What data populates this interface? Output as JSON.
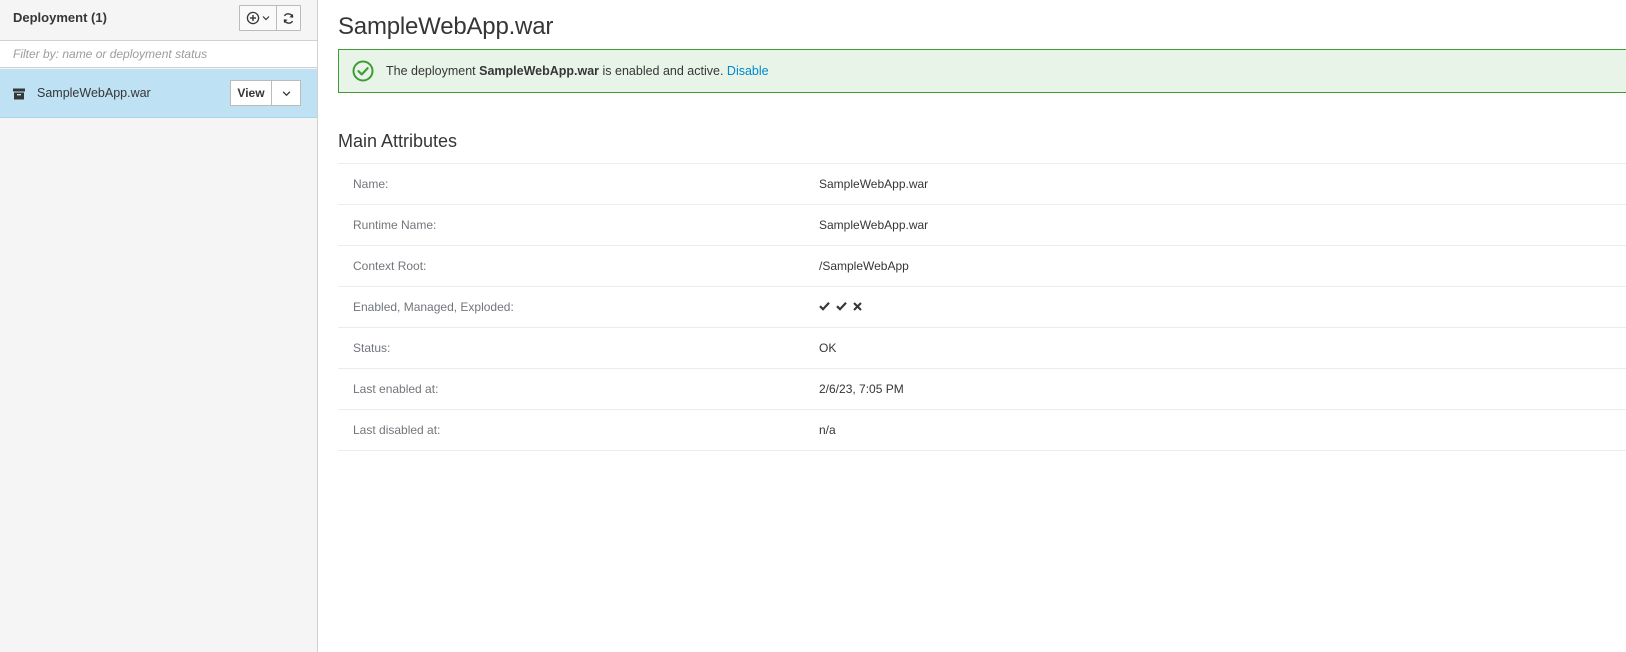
{
  "sidebar": {
    "title": "Deployment (1)",
    "add_icon": "plus-circle-icon",
    "refresh_icon": "refresh-icon",
    "filter_placeholder": "Filter by: name or deployment status",
    "items": [
      {
        "label": "SampleWebApp.war",
        "icon": "archive-icon",
        "view_label": "View"
      }
    ]
  },
  "main": {
    "title": "SampleWebApp.war",
    "alert": {
      "prefix": "The deployment ",
      "name": "SampleWebApp.war",
      "suffix": " is enabled and active. ",
      "action": "Disable",
      "icon": "check-circle-icon",
      "color": "#3f9c35"
    },
    "section_title": "Main Attributes",
    "attributes": {
      "name": {
        "label": "Name:",
        "value": "SampleWebApp.war"
      },
      "runtime_name": {
        "label": "Runtime Name:",
        "value": "SampleWebApp.war"
      },
      "context_root": {
        "label": "Context Root:",
        "value": "/SampleWebApp"
      },
      "flags": {
        "label": "Enabled, Managed, Exploded:",
        "enabled": true,
        "managed": true,
        "exploded": false
      },
      "status": {
        "label": "Status:",
        "value": "OK"
      },
      "last_enabled": {
        "label": "Last enabled at:",
        "value": "2/6/23, 7:05 PM"
      },
      "last_disabled": {
        "label": "Last disabled at:",
        "value": "n/a"
      }
    }
  },
  "colors": {
    "selected_bg": "#bee1f4",
    "link": "#0088ce",
    "success_bg": "#e9f4e9",
    "success_border": "#3f9c35"
  }
}
